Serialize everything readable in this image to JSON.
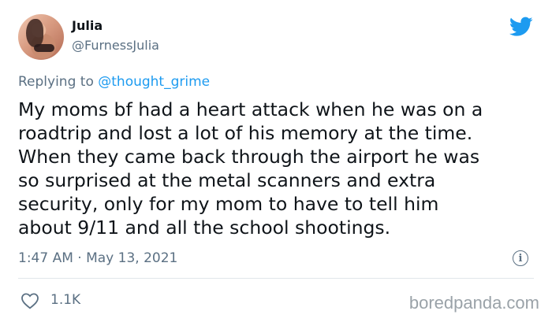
{
  "tweet": {
    "author_name": "Julia",
    "author_handle": "@FurnessJulia",
    "reply_prefix": "Replying to",
    "reply_mention": "@thought_grime",
    "text": "My moms bf had a heart attack when he was on a\nroadtrip and lost a lot of his memory at the time.\nWhen they came back through the airport he was\nso surprised at the metal scanners and extra\nsecurity, only for my mom to have to tell him\nabout 9/11 and all the school shootings.",
    "timestamp": "1:47 AM · May 13, 2021",
    "likes": "1.1K"
  },
  "icons": {
    "platform": "twitter-bird-icon",
    "info": "info-icon",
    "like": "heart-icon"
  },
  "info_glyph": "i",
  "watermark": "boredpanda.com",
  "colors": {
    "accent": "#1d9bf0",
    "text_primary": "#0f1419",
    "text_secondary": "#5b7083",
    "divider": "#e1e6ea",
    "watermark": "#9aa2a8"
  }
}
